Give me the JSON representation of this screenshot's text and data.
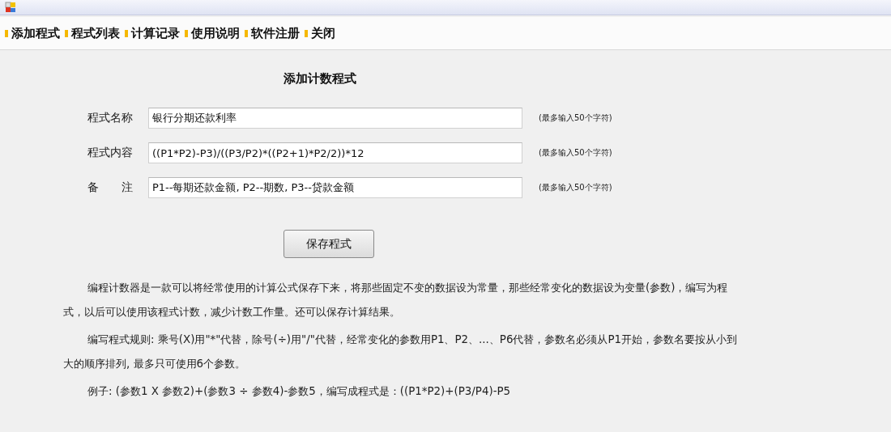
{
  "menu": [
    {
      "label": "添加程式"
    },
    {
      "label": "程式列表"
    },
    {
      "label": "计算记录"
    },
    {
      "label": "使用说明"
    },
    {
      "label": "软件注册"
    },
    {
      "label": "关闭"
    }
  ],
  "form": {
    "title": "添加计数程式",
    "fields": [
      {
        "label": "程式名称",
        "value": "银行分期还款利率",
        "hint": "(最多输入50个字符)"
      },
      {
        "label": "程式内容",
        "value": "((P1*P2)-P3)/((P3/P2)*((P2+1)*P2/2))*12",
        "hint": "(最多输入50个字符)"
      },
      {
        "label": "备　　注",
        "value": "P1--每期还款金额, P2--期数, P3--贷款金额",
        "hint": "(最多输入50个字符)"
      }
    ],
    "save_button": "保存程式"
  },
  "description": [
    "编程计数器是一款可以将经常使用的计算公式保存下来，将那些固定不变的数据设为常量，那些经常变化的数据设为变量(参数)，编写为程式，以后可以使用该程式计数，减少计数工作量。还可以保存计算结果。",
    "编写程式规则: 乘号(X)用\"*\"代替，除号(÷)用\"/\"代替，经常变化的参数用P1、P2、...、P6代替，参数名必须从P1开始，参数名要按从小到大的顺序排列, 最多只可使用6个参数。",
    "例子: (参数1 X 参数2)+(参数3 ÷ 参数4)-参数5，编写成程式是：((P1*P2)+(P3/P4)-P5"
  ]
}
